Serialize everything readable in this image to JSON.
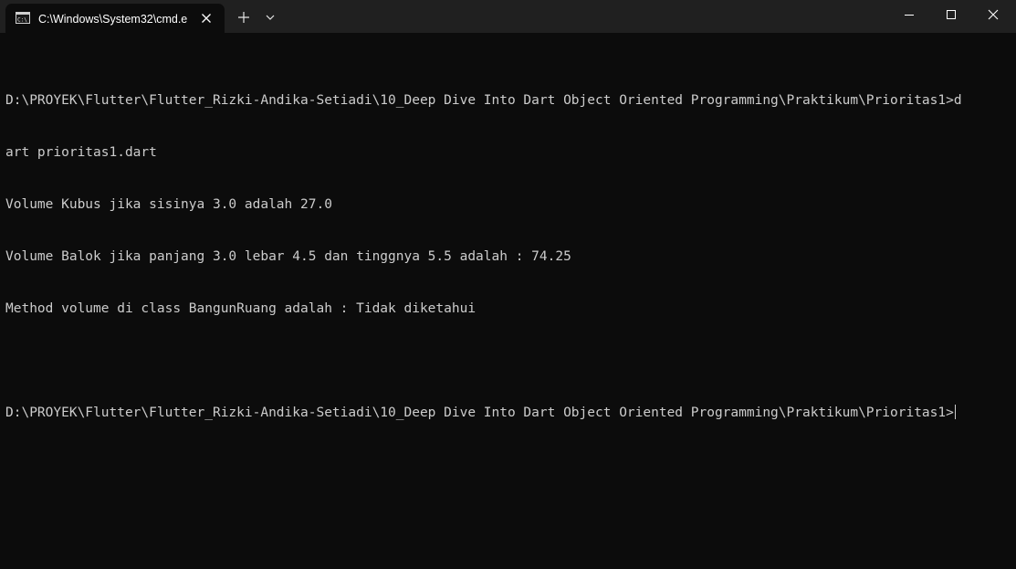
{
  "window": {
    "tab_title": "C:\\Windows\\System32\\cmd.e",
    "tab_icon": "cmd-icon",
    "colors": {
      "titlebar": "#202020",
      "background": "#0c0c0c",
      "text": "#cccccc"
    }
  },
  "terminal": {
    "lines": [
      "D:\\PROYEK\\Flutter\\Flutter_Rizki-Andika-Setiadi\\10_Deep Dive Into Dart Object Oriented Programming\\Praktikum\\Prioritas1>d",
      "art prioritas1.dart",
      "Volume Kubus jika sisinya 3.0 adalah 27.0",
      "Volume Balok jika panjang 3.0 lebar 4.5 dan tinggnya 5.5 adalah : 74.25",
      "Method volume di class BangunRuang adalah : Tidak diketahui",
      "",
      "D:\\PROYEK\\Flutter\\Flutter_Rizki-Andika-Setiadi\\10_Deep Dive Into Dart Object Oriented Programming\\Praktikum\\Prioritas1>"
    ]
  }
}
